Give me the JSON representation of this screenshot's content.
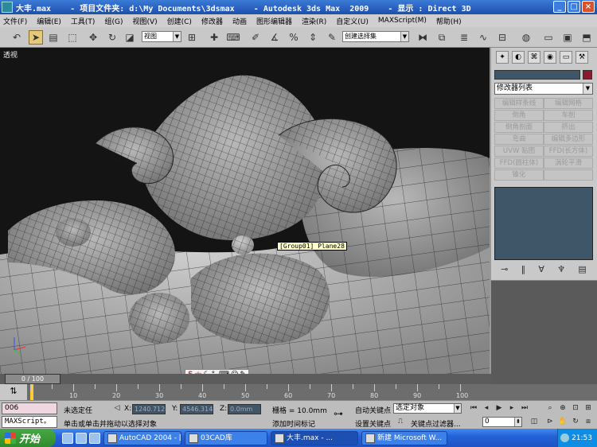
{
  "window": {
    "title": "大丰.max    - 项目文件夹: d:\\My Documents\\3dsmax    - Autodesk 3ds Max  2009    - 显示 : Direct 3D",
    "controls": [
      "_",
      "□",
      "×"
    ]
  },
  "menu": [
    "文件(F)",
    "编辑(E)",
    "工具(T)",
    "组(G)",
    "视图(V)",
    "创建(C)",
    "修改器",
    "动画",
    "图形编辑器",
    "渲染(R)",
    "自定义(U)",
    "MAXScript(M)",
    "帮助(H)"
  ],
  "toolbar": {
    "coord_system": "视图",
    "selection_set": "创建选择集"
  },
  "viewport": {
    "label": "透视",
    "tooltip": "[Group01] Plane28",
    "ime_label": "中"
  },
  "command_panel": {
    "modifier_list": "修改器列表",
    "modifiers": [
      "编辑样条线",
      "编辑网格",
      "倒角",
      "车削",
      "倒角剖面",
      "挤出",
      "弯曲",
      "编辑多边形",
      "UVW 贴图",
      "FFD(长方体)",
      "FFD(圆柱体)",
      "涡轮平滑",
      "锥化",
      ""
    ]
  },
  "timeline": {
    "frame_display": "0 / 100",
    "ticks": [
      "0",
      "10",
      "20",
      "30",
      "40",
      "50",
      "60",
      "70",
      "80",
      "90",
      "100"
    ]
  },
  "status": {
    "maxscript_value": "006",
    "maxscript_label": "MAXScript。",
    "selection": "未选定任",
    "prompt": "单击或单击并拖动以选择对象",
    "x_label": "X:",
    "x_value": "1240.712r",
    "y_label": "Y:",
    "y_value": "4546.314r",
    "z_label": "Z:",
    "z_value": "0.0mm",
    "grid": "栅格 = 10.0mm",
    "add_time_tag": "添加时间标记",
    "auto_key": "自动关键点",
    "set_key": "设置关键点",
    "selected_object": "选定对象",
    "key_filters": "关键点过滤器...",
    "frame_field": "0"
  },
  "taskbar": {
    "start": "开始",
    "tasks": [
      {
        "label": "AutoCAD 2004 - [...",
        "active": false
      },
      {
        "label": "03CAD库",
        "active": false
      },
      {
        "label": "大丰.max    - ...",
        "active": true
      },
      {
        "label": "新建 Microsoft W...",
        "active": false
      }
    ],
    "clock": "21:53"
  }
}
